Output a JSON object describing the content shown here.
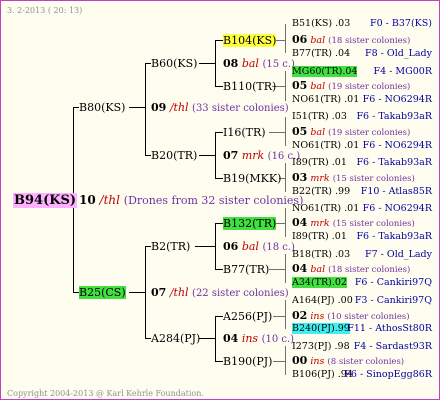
{
  "header": "3. 2-2013 ( 20: 13)",
  "footer": "Copyright 2004-2013 @ Karl Kehrle Foundation.",
  "root": {
    "id": "B94(KS)",
    "gen": "10",
    "mark": "/thl",
    "note": "(Drones from 32 sister colonies)"
  },
  "g1": {
    "upper": {
      "id": "B80(KS)",
      "gen": "09",
      "mark": "/thl",
      "note": "(33 sister colonies)"
    },
    "lower": {
      "id": "B25(CS)",
      "gen": "07",
      "mark": "/thl",
      "note": "(22 sister colonies)"
    }
  },
  "g2": {
    "b60": {
      "id": "B60(KS)",
      "gen": "08",
      "mark": "bal",
      "note": "(15 c.)"
    },
    "b20": {
      "id": "B20(TR)",
      "gen": "07",
      "mark": "mrk",
      "note": "(16 c.)"
    },
    "b2": {
      "id": "B2(TR)",
      "gen": "06",
      "mark": "bal",
      "note": "(18 c.)"
    },
    "a284": {
      "id": "A284(PJ)",
      "gen": "04",
      "mark": "ins",
      "note": "(10 c.)"
    }
  },
  "g3": {
    "b104": "B104(KS)",
    "b110": "B110(TR)",
    "i16": "I16(TR)",
    "b19": "B19(MKK)",
    "b132": "B132(TR)",
    "b77": "B77(TR)",
    "a256": "A256(PJ)",
    "b190": "B190(PJ)"
  },
  "g4": [
    {
      "id": "B51(KS)",
      "num": ".03",
      "origin": "F0 - B37(KS)"
    },
    {
      "gen": "06",
      "mark": "bal",
      "note": "(18 sister colonies)"
    },
    {
      "id": "B77(TR)",
      "num": ".04",
      "origin": "F8 - Old_Lady"
    },
    {
      "id": "MG60(TR)",
      "num": ".04",
      "origin": "F4 - MG00R"
    },
    {
      "gen": "05",
      "mark": "bal",
      "note": "(19 sister colonies)"
    },
    {
      "id": "NO61(TR)",
      "num": ".01",
      "origin": "F6 - NO6294R"
    },
    {
      "id": "I51(TR)",
      "num": ".03",
      "origin": "F6 - Takab93aR"
    },
    {
      "gen": "05",
      "mark": "bal",
      "note": "(19 sister colonies)"
    },
    {
      "id": "NO61(TR)",
      "num": ".01",
      "origin": "F6 - NO6294R"
    },
    {
      "id": "I89(TR)",
      "num": ".01",
      "origin": "F6 - Takab93aR"
    },
    {
      "gen": "03",
      "mark": "mrk",
      "note": "(15 sister colonies)"
    },
    {
      "id": "B22(TR)",
      "num": ".99",
      "origin": "F10 - Atlas85R"
    },
    {
      "id": "NO61(TR)",
      "num": ".01",
      "origin": "F6 - NO6294R"
    },
    {
      "gen": "04",
      "mark": "mrk",
      "note": "(15 sister colonies)"
    },
    {
      "id": "I89(TR)",
      "num": ".01",
      "origin": "F6 - Takab93aR"
    },
    {
      "id": "B18(TR)",
      "num": ".03",
      "origin": "F7 - Old_Lady"
    },
    {
      "gen": "04",
      "mark": "bal",
      "note": "(18 sister colonies)"
    },
    {
      "id": "A34(TR)",
      "num": ".02",
      "origin": "F6 - Cankiri97Q"
    },
    {
      "id": "A164(PJ)",
      "num": ".00",
      "origin": "F3 - Cankiri97Q"
    },
    {
      "gen": "02",
      "mark": "ins",
      "note": "(10 sister colonies)"
    },
    {
      "id": "B240(PJ)",
      "num": ".99",
      "origin": "F11 - AthosSt80R"
    },
    {
      "id": "I273(PJ)",
      "num": ".98",
      "origin": "F4 - Sardast93R"
    },
    {
      "gen": "00",
      "mark": "ins",
      "note": "(8 sister colonies)"
    },
    {
      "id": "B106(PJ)",
      "num": ".94",
      "origin": "F6 - SinopEgg86R"
    }
  ]
}
